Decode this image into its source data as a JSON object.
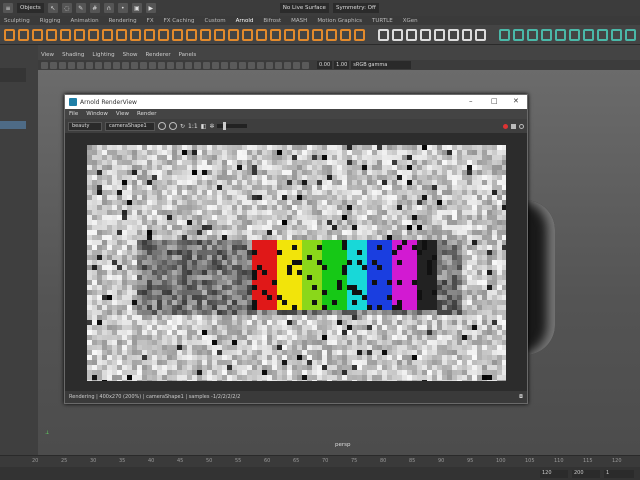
{
  "top_bar": {
    "workspace_selector": "Objects",
    "live_surface": "No Live Surface",
    "symmetry": "Symmetry: Off"
  },
  "shelf_tabs": [
    "Sculpting",
    "Rigging",
    "Animation",
    "Rendering",
    "FX",
    "FX Caching",
    "Custom",
    "Arnold",
    "Bifrost",
    "MASH",
    "Motion Graphics",
    "TURTLE",
    "XGen"
  ],
  "viewport_menu": [
    "View",
    "Shading",
    "Lighting",
    "Show",
    "Renderer",
    "Panels"
  ],
  "viewport_toolbar": {
    "exposure": "0.00",
    "gamma": "1.00",
    "color_space": "sRGB gamma"
  },
  "viewport": {
    "camera_label": "persp"
  },
  "timeline": {
    "ticks": [
      "20",
      "25",
      "30",
      "35",
      "40",
      "45",
      "50",
      "55",
      "60",
      "65",
      "70",
      "75",
      "80",
      "85",
      "90",
      "95",
      "100",
      "105",
      "110",
      "115",
      "120"
    ],
    "range_fields": [
      "120",
      "200",
      "1"
    ]
  },
  "render_view": {
    "title": "Arnold RenderView",
    "menu": [
      "File",
      "Window",
      "View",
      "Render"
    ],
    "aov": "beauty",
    "camera": "cameraShape1",
    "ratio": "1:1",
    "status": "Rendering | 400x270 (200%) | cameraShape1 | samples -1/2/2/2/2/2"
  },
  "colors": {
    "shelf_orange": "#e38a2c",
    "shelf_teal": "#4ab8a8",
    "selection_blue": "#4e6b86",
    "arnold_blue": "#1f7fa7"
  }
}
